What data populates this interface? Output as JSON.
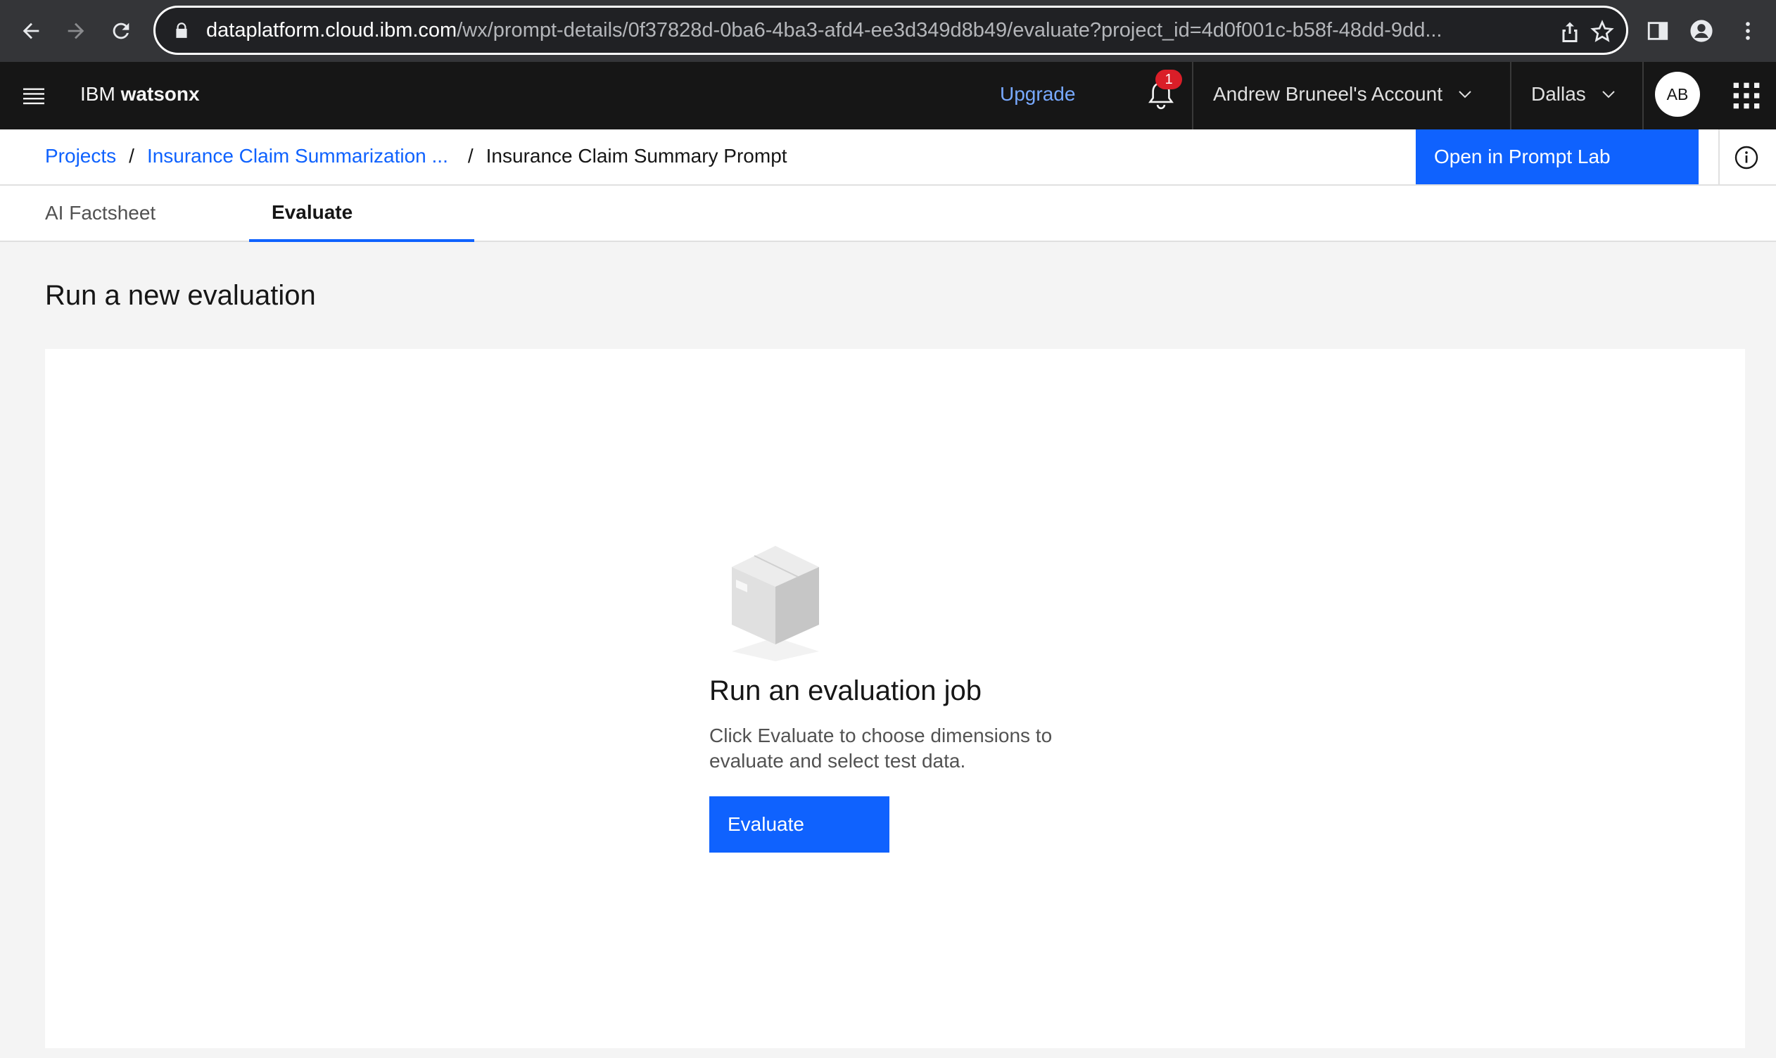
{
  "browser": {
    "url_host": "dataplatform.cloud.ibm.com",
    "url_path": "/wx/prompt-details/0f37828d-0ba6-4ba3-afd4-ee3d349d8b49/evaluate?project_id=4d0f001c-b58f-48dd-9dd..."
  },
  "header": {
    "brand_prefix": "IBM ",
    "brand_product": "watsonx",
    "upgrade_label": "Upgrade",
    "notification_count": "1",
    "account_label": "Andrew Bruneel's Account",
    "region_label": "Dallas",
    "avatar_initials": "AB"
  },
  "breadcrumb": {
    "items": [
      {
        "label": "Projects"
      },
      {
        "label": "Insurance Claim Summarization ..."
      }
    ],
    "separator": "/",
    "current": "Insurance Claim Summary Prompt"
  },
  "open_prompt_lab_label": "Open in Prompt Lab",
  "tabs": [
    {
      "label": "AI Factsheet"
    },
    {
      "label": "Evaluate"
    }
  ],
  "main": {
    "section_title": "Run a new evaluation",
    "empty_title": "Run an evaluation job",
    "empty_description": "Click Evaluate to choose dimensions to evaluate and select test data.",
    "evaluate_button": "Evaluate"
  },
  "colors": {
    "primary_blue": "#0f62fe",
    "header_bg": "#161616",
    "badge_red": "#da1e28"
  }
}
